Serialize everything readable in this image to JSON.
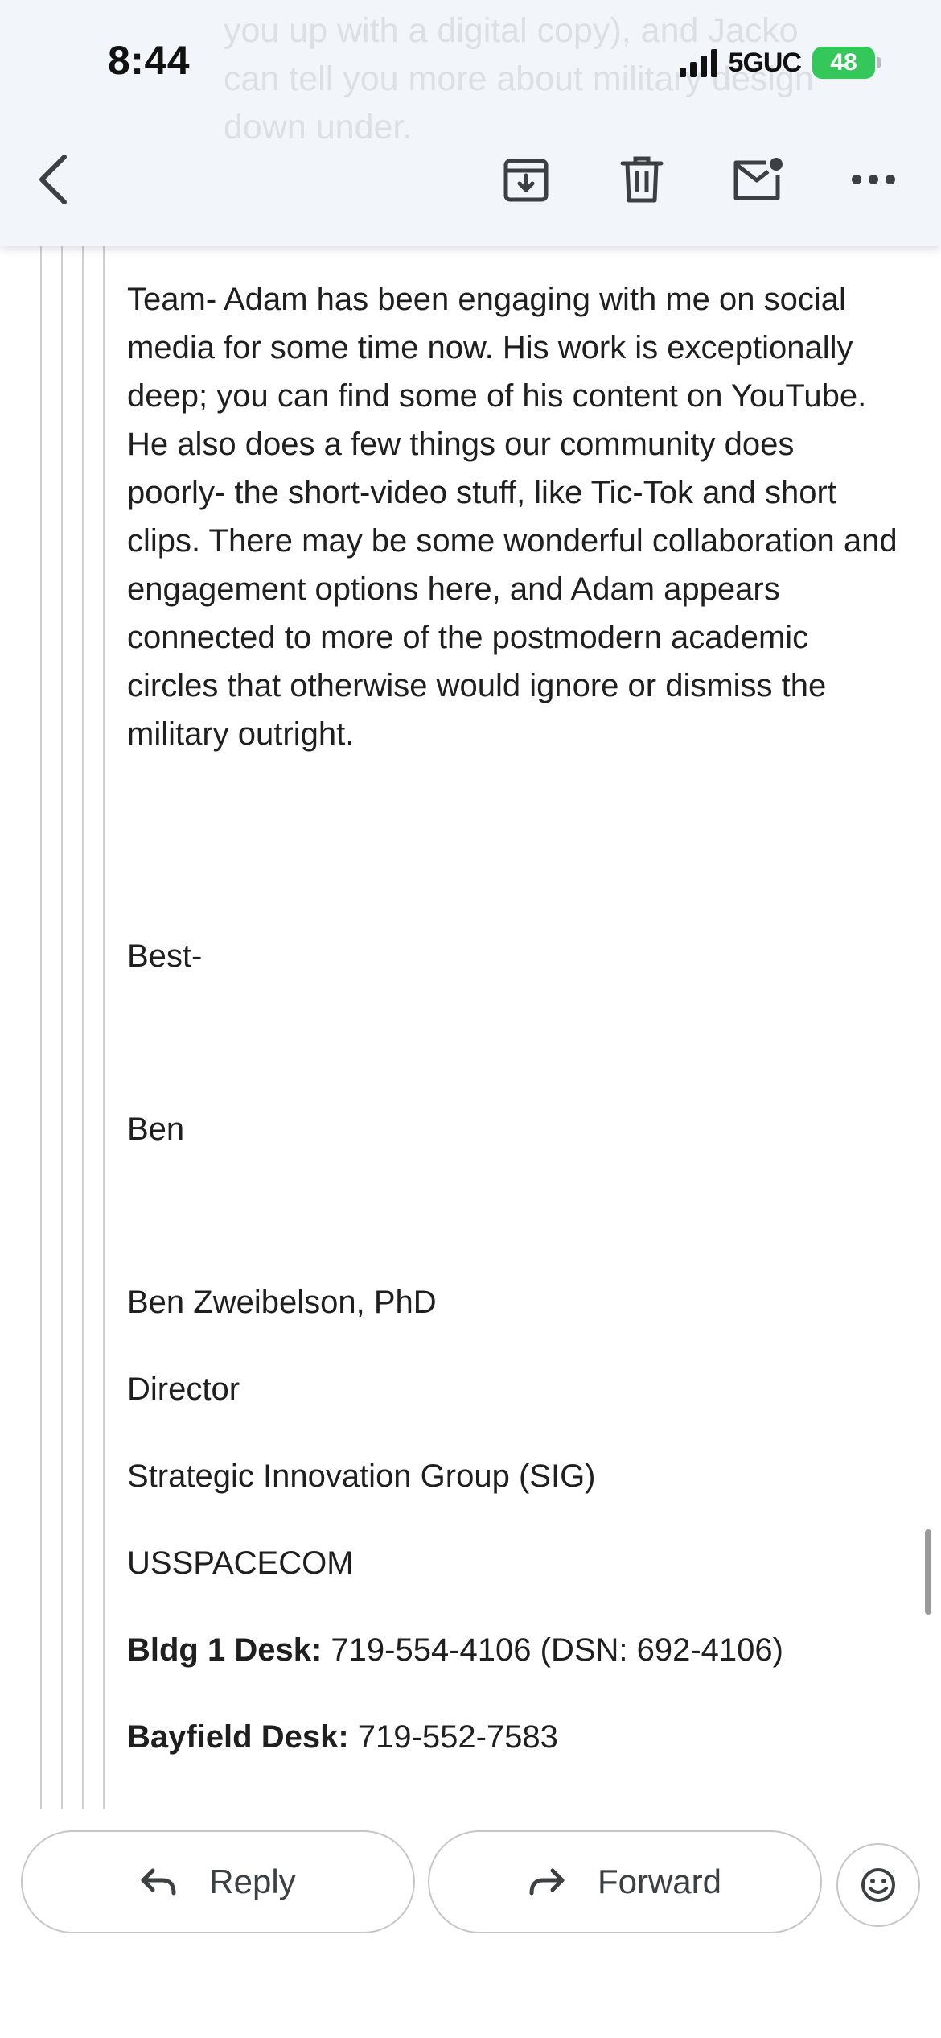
{
  "status_bar": {
    "time": "8:44",
    "network": "5GUC",
    "battery": "48"
  },
  "header_peek_text": "you up with a digital copy), and Jacko\ncan tell you more about military design\ndown under.",
  "toolbar": {
    "back_icon": "chevron-left-icon",
    "archive_icon": "archive-icon",
    "delete_icon": "trash-icon",
    "mark_unread_icon": "mail-unread-icon",
    "more_icon": "more-horizontal-icon"
  },
  "body": {
    "paragraph": "Team- Adam has been engaging with me on social media for some time now. His work is exceptionally deep; you can find some of his content on YouTube. He also does a few things our community does poorly- the short-video stuff, like Tic-Tok and short clips.  There may be some wonderful collaboration and engagement options here, and Adam appears connected to more of the postmodern academic circles that otherwise would ignore or dismiss the military outright.",
    "closing": "Best-",
    "sender_first": "Ben",
    "signature": {
      "name": "Ben Zweibelson, PhD",
      "title": "Director",
      "group": "Strategic Innovation Group (SIG)",
      "org": "USSPACECOM",
      "bldg_label": "Bldg 1 Desk:",
      "bldg_value": " 719-554-4106 (DSN: 692-4106)",
      "bayfield_label": "Bayfield Desk:",
      "bayfield_value": " 719-552-7583"
    }
  },
  "actions": {
    "reply_label": "Reply",
    "forward_label": "Forward"
  },
  "colors": {
    "header_bg": "#f2f5fa",
    "battery_green": "#34c759",
    "text": "#1f1f1f"
  }
}
